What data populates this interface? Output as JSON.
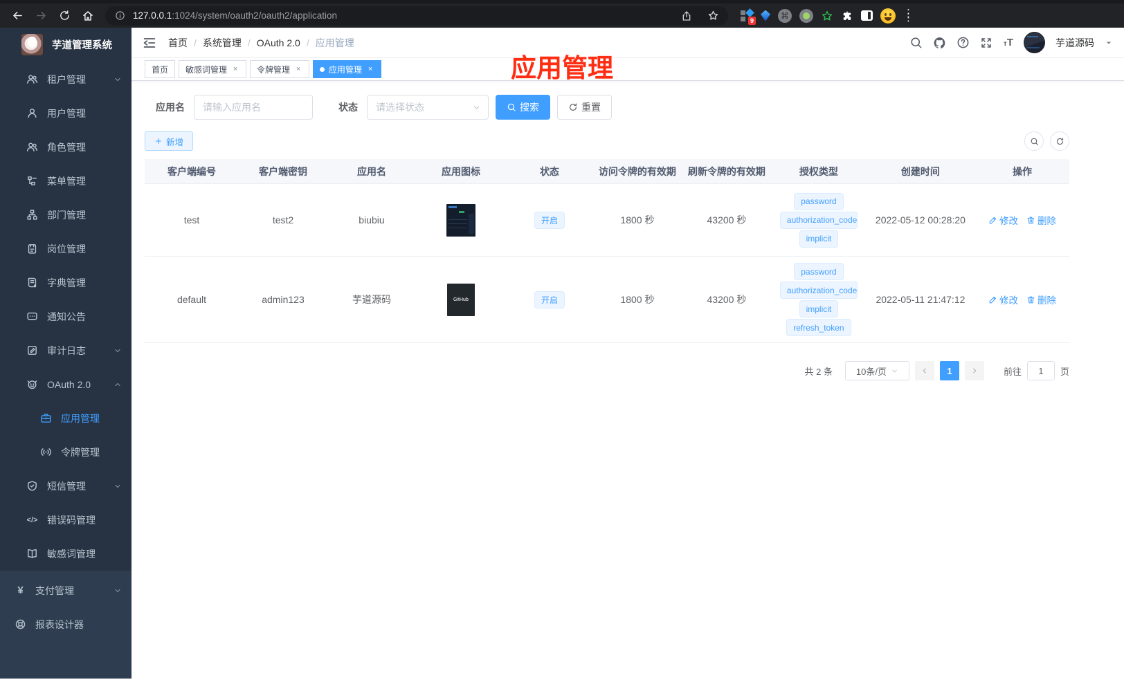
{
  "browser": {
    "url_host": "127.0.0.1",
    "url_path": ":1024/system/oauth2/oauth2/application",
    "extension_badge": "9"
  },
  "sidebar": {
    "app_title": "芋道管理系统",
    "items": [
      {
        "label": "租户管理"
      },
      {
        "label": "用户管理"
      },
      {
        "label": "角色管理"
      },
      {
        "label": "菜单管理"
      },
      {
        "label": "部门管理"
      },
      {
        "label": "岗位管理"
      },
      {
        "label": "字典管理"
      },
      {
        "label": "通知公告"
      },
      {
        "label": "审计日志"
      },
      {
        "label": "OAuth 2.0"
      }
    ],
    "oauth_children": [
      {
        "label": "应用管理"
      },
      {
        "label": "令牌管理"
      }
    ],
    "items2": [
      {
        "label": "短信管理"
      },
      {
        "label": "错误码管理"
      },
      {
        "label": "敏感词管理"
      }
    ],
    "items3": [
      {
        "label": "支付管理"
      },
      {
        "label": "报表设计器"
      }
    ]
  },
  "navbar": {
    "breadcrumb": [
      "首页",
      "系统管理",
      "OAuth 2.0",
      "应用管理"
    ],
    "separator": "/",
    "username": "芋道源码"
  },
  "tabs": [
    {
      "label": "首页"
    },
    {
      "label": "敏感词管理"
    },
    {
      "label": "令牌管理"
    },
    {
      "label": "应用管理"
    }
  ],
  "annotation": {
    "text": "应用管理",
    "color": "#ff2d12"
  },
  "filter": {
    "name_label": "应用名",
    "name_placeholder": "请输入应用名",
    "status_label": "状态",
    "status_placeholder": "请选择状态",
    "search_label": "搜索",
    "reset_label": "重置"
  },
  "toolbar": {
    "add_label": "新增"
  },
  "table": {
    "columns": [
      "客户端编号",
      "客户端密钥",
      "应用名",
      "应用图标",
      "状态",
      "访问令牌的有效期",
      "刷新令牌的有效期",
      "授权类型",
      "创建时间",
      "操作"
    ],
    "edit_label": "修改",
    "delete_label": "删除",
    "rows": [
      {
        "client_id": "test",
        "secret": "test2",
        "name": "biubiu",
        "status": "开启",
        "access_validity": "1800 秒",
        "refresh_validity": "43200 秒",
        "grants": [
          "password",
          "authorization_code",
          "implicit"
        ],
        "created": "2022-05-12 00:28:20"
      },
      {
        "client_id": "default",
        "secret": "admin123",
        "name": "芋道源码",
        "icon_text": "GitHub",
        "status": "开启",
        "access_validity": "1800 秒",
        "refresh_validity": "43200 秒",
        "grants": [
          "password",
          "authorization_code",
          "implicit",
          "refresh_token"
        ],
        "created": "2022-05-11 21:47:12"
      }
    ]
  },
  "pagination": {
    "total": "共 2 条",
    "page_size": "10条/页",
    "page": "1",
    "goto_label": "前往",
    "goto_value": "1",
    "page_unit": "页"
  },
  "colors": {
    "accent": "#409eff",
    "tag_bg": "#ecf5ff",
    "sidebar_bg": "#273343"
  }
}
